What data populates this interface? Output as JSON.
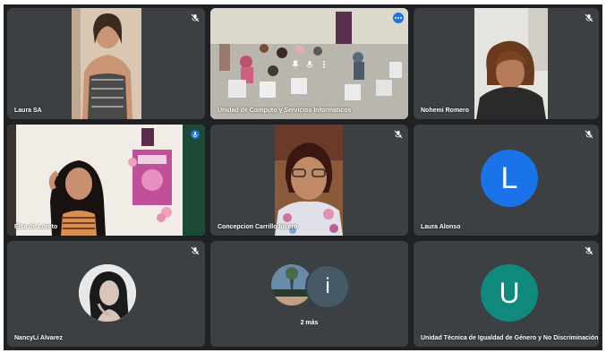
{
  "meeting": {
    "tiles": [
      {
        "name": "Laura SA",
        "muted": true,
        "type": "video"
      },
      {
        "name": "Unidad de Computo y Servicios Informaticos",
        "muted": false,
        "type": "video",
        "active": true
      },
      {
        "name": "Nohemi Romero",
        "muted": true,
        "type": "video"
      },
      {
        "name": "Elsa de Loreto",
        "muted": false,
        "type": "video"
      },
      {
        "name": "Concepcion Carrillo lucero",
        "muted": true,
        "type": "video"
      },
      {
        "name": "Laura Alonso",
        "muted": true,
        "type": "avatar",
        "initial": "L",
        "color": "#1a73e8"
      },
      {
        "name": "NancyLi Alvarez",
        "muted": true,
        "type": "photo"
      },
      {
        "name": "",
        "type": "overflow",
        "initial": "i",
        "count_label": "2 más"
      },
      {
        "name": "Unidad Técnica de Igualdad de Género y No Discriminación",
        "muted": true,
        "type": "avatar",
        "initial": "U",
        "color": "#0f8a7d"
      }
    ]
  },
  "colors": {
    "background": "#202124",
    "tile": "#3c4043",
    "active_outline": "#8ab4f8",
    "more_button": "#1a73e8",
    "overflow_avatar": "#455a64"
  }
}
